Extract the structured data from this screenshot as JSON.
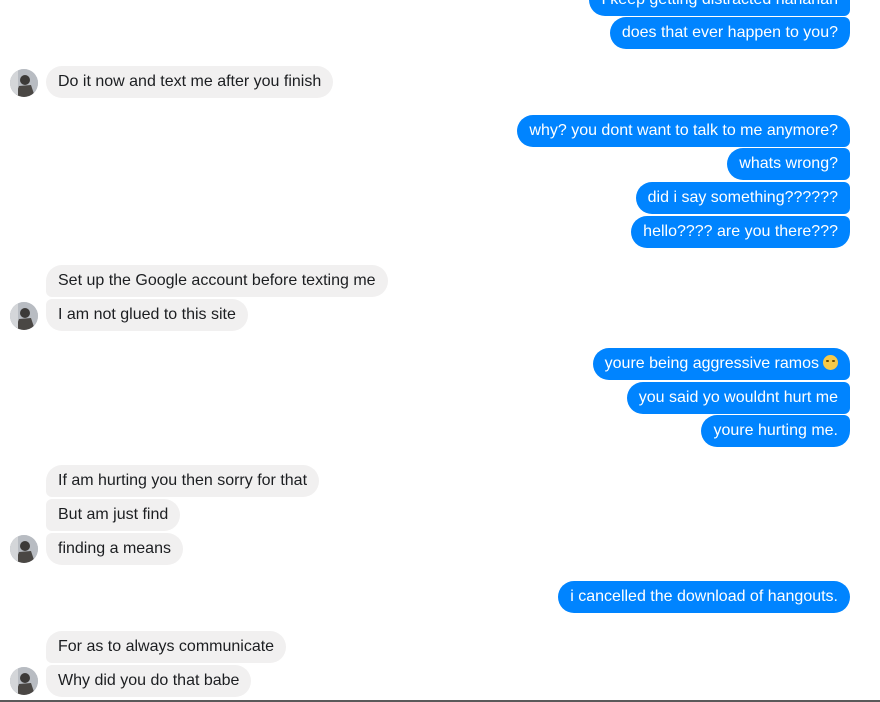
{
  "messages": [
    {
      "side": "out",
      "text": "I keep getting distracted hahahah"
    },
    {
      "side": "out",
      "text": "does that ever happen to you?"
    },
    {
      "side": "in",
      "text": "Do it now and text me after you finish"
    },
    {
      "side": "out",
      "text": "why? you dont want to talk to me anymore?"
    },
    {
      "side": "out",
      "text": "whats wrong?"
    },
    {
      "side": "out",
      "text": "did i say something??????"
    },
    {
      "side": "out",
      "text": "hello???? are you there???"
    },
    {
      "side": "in",
      "text": "Set up the Google account before texting me"
    },
    {
      "side": "in",
      "text": "I am not glued to this site"
    },
    {
      "side": "out",
      "text": "youre being aggressive ramos",
      "emoji": "disappointed-face"
    },
    {
      "side": "out",
      "text": "you said yo wouldnt hurt me"
    },
    {
      "side": "out",
      "text": "youre hurting me."
    },
    {
      "side": "in",
      "text": "If am hurting you then sorry for that"
    },
    {
      "side": "in",
      "text": "But am just find"
    },
    {
      "side": "in",
      "text": "finding a means"
    },
    {
      "side": "out",
      "text": "i cancelled the download of hangouts."
    },
    {
      "side": "in",
      "text": "For as to always communicate"
    },
    {
      "side": "in",
      "text": "Why did you do that babe"
    }
  ],
  "colors": {
    "outgoing_bubble": "#0084ff",
    "incoming_bubble": "#f1f0f0",
    "outgoing_text": "#ffffff",
    "incoming_text": "#1c1e21"
  }
}
